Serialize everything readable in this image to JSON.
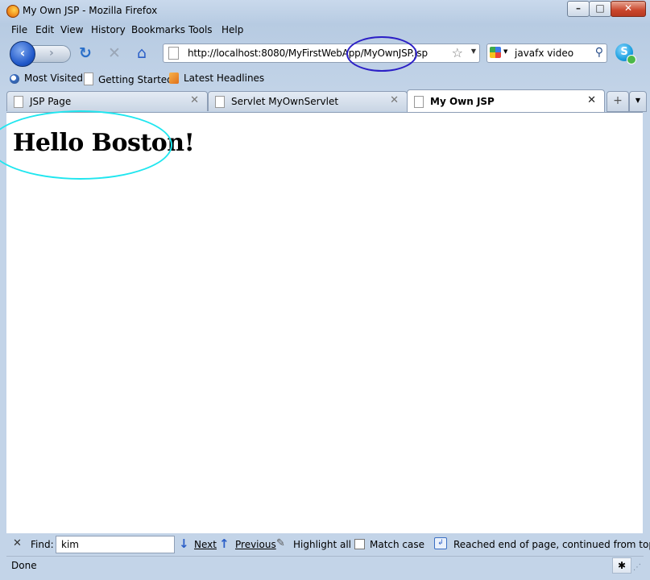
{
  "window": {
    "title": "My Own JSP - Mozilla Firefox"
  },
  "menu": [
    "File",
    "Edit",
    "View",
    "History",
    "Bookmarks",
    "Tools",
    "Help"
  ],
  "nav": {
    "url": "http://localhost:8080/MyFirstWebApp/MyOwnJSP.jsp",
    "search_value": "javafx video"
  },
  "bookmarks": [
    "Most Visited",
    "Getting Started",
    "Latest Headlines"
  ],
  "tabs": [
    {
      "label": "JSP Page",
      "active": false
    },
    {
      "label": "Servlet MyOwnServlet",
      "active": false
    },
    {
      "label": "My Own JSP",
      "active": true
    }
  ],
  "page": {
    "heading": "Hello Boston!"
  },
  "findbar": {
    "label": "Find:",
    "value": "kim",
    "next": "Next",
    "previous": "Previous",
    "highlight": "Highlight all",
    "match_case": "Match case",
    "match_case_checked": false,
    "status": "Reached end of page, continued from top"
  },
  "statusbar": {
    "text": "Done"
  },
  "annotations": {
    "url_ellipse_color": "#2b1fc6",
    "heading_ellipse_color": "#20e6ef"
  }
}
